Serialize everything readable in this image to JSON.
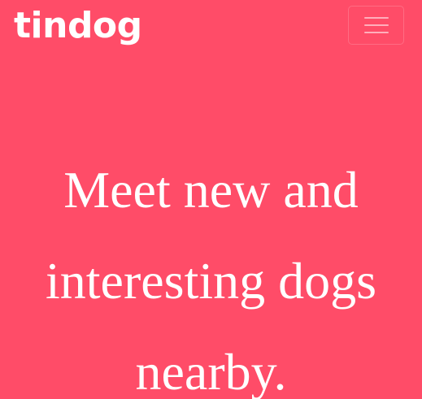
{
  "navbar": {
    "brand": "tindog",
    "menu_icon": "hamburger-menu-icon"
  },
  "hero": {
    "title_lines": [
      "Meet new and",
      "interesting dogs",
      "nearby."
    ]
  },
  "colors": {
    "background": "#ff4c68",
    "text": "#ffffff"
  }
}
